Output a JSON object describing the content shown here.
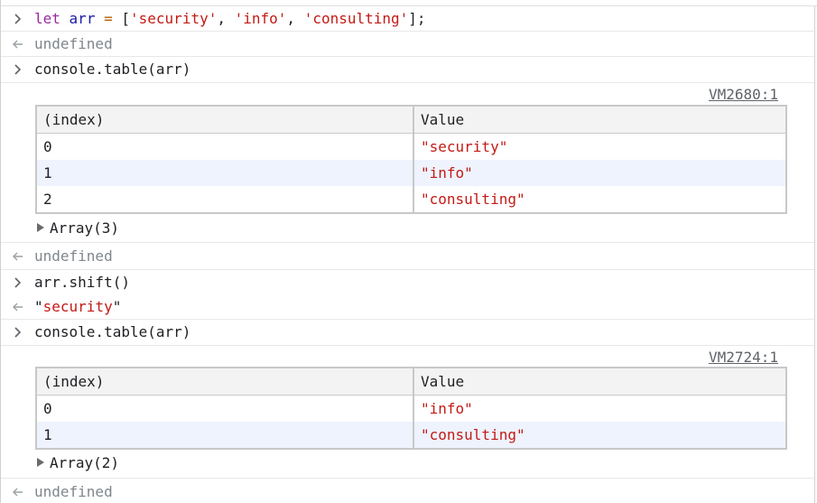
{
  "entries": {
    "e1_input": {
      "kw": "let",
      "var": "arr",
      "op": "=",
      "lb": "[",
      "s1": "'security'",
      "c1": ",",
      "s2": "'info'",
      "c2": ",",
      "s3": "'consulting'",
      "end": "];"
    },
    "e1_result": "undefined",
    "e2_input": "console.table(arr)",
    "e2_source": "VM2680:1",
    "table1": {
      "headers": [
        "(index)",
        "Value"
      ],
      "rows": [
        {
          "index": "0",
          "value": "\"security\""
        },
        {
          "index": "1",
          "value": "\"info\""
        },
        {
          "index": "2",
          "value": "\"consulting\""
        }
      ],
      "summary": "Array(3)"
    },
    "e2_result": "undefined",
    "e3_input": "arr.shift()",
    "e3_result": {
      "q1": "\"",
      "val": "security",
      "q2": "\""
    },
    "e4_input": "console.table(arr)",
    "e4_source": "VM2724:1",
    "table2": {
      "headers": [
        "(index)",
        "Value"
      ],
      "rows": [
        {
          "index": "0",
          "value": "\"info\""
        },
        {
          "index": "1",
          "value": "\"consulting\""
        }
      ],
      "summary": "Array(2)"
    },
    "e4_result": "undefined"
  }
}
